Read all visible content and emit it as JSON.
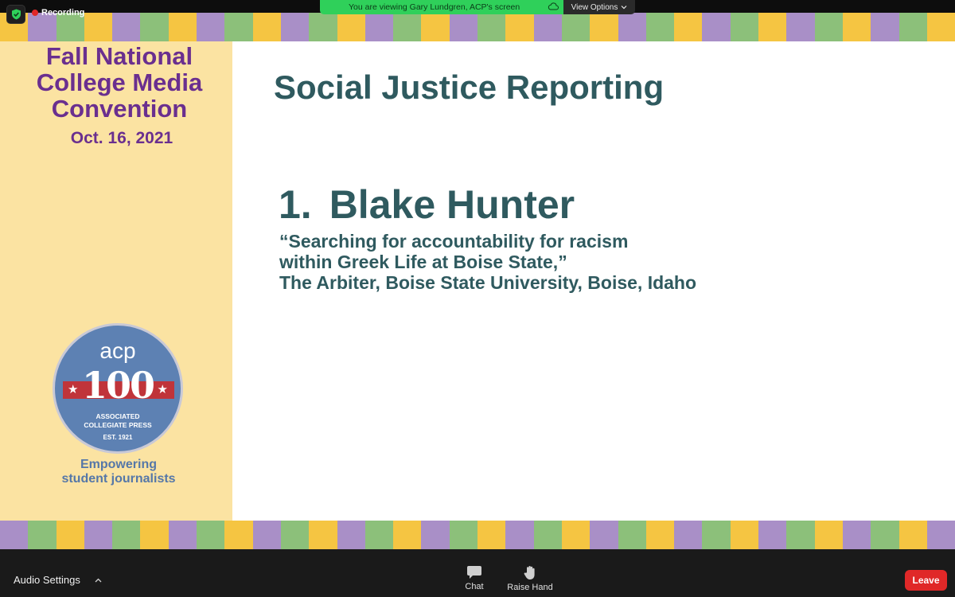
{
  "recording": {
    "label": "Recording"
  },
  "share_banner": {
    "text": "You are viewing Gary Lundgren, ACP's screen",
    "view_options": "View Options"
  },
  "slide": {
    "conference": {
      "line1": "Fall National",
      "line2": "College Media",
      "line3": "Convention",
      "date": "Oct. 16, 2021"
    },
    "logo": {
      "acp": "acp",
      "number": "100",
      "line1": "ASSOCIATED",
      "line2": "COLLEGIATE PRESS",
      "line3": "EST. 1921"
    },
    "tagline": {
      "line1": "Empowering",
      "line2": "student journalists"
    },
    "title": "Social Justice Reporting",
    "honoree": {
      "number": "1.",
      "name": "Blake Hunter",
      "line1": "“Searching for accountability for racism",
      "line2": "within Greek Life at Boise State,”",
      "line3": "The Arbiter, Boise State University, Boise, Idaho"
    }
  },
  "toolbar": {
    "audio_settings": "Audio Settings",
    "chat": "Chat",
    "raise_hand": "Raise Hand",
    "leave": "Leave"
  },
  "colors": {
    "accent_green": "#2fd05a",
    "leave_red": "#e02828",
    "title_teal": "#2f5a5f",
    "conference_purple": "#6a2f8f"
  },
  "icons": {
    "security": "shield-check-icon",
    "chat": "chat-bubble-icon",
    "raise_hand": "hand-icon",
    "audio_menu": "chevron-up-icon"
  }
}
